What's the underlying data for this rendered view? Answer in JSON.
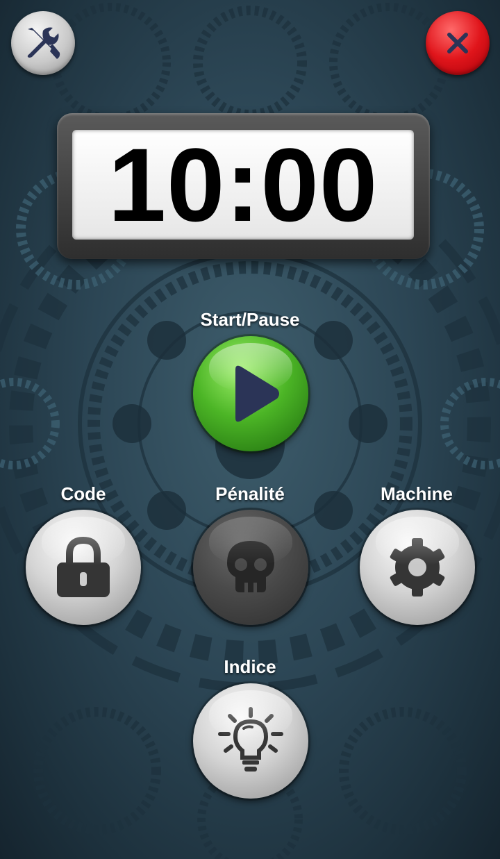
{
  "timer": {
    "display": "10:00"
  },
  "header": {
    "tools_icon": "tools-icon",
    "close_icon": "close-icon"
  },
  "controls": {
    "start_pause": {
      "label": "Start/Pause",
      "icon": "play-icon"
    },
    "code": {
      "label": "Code",
      "icon": "lock-icon"
    },
    "penalty": {
      "label": "Pénalité",
      "icon": "skull-icon"
    },
    "machine": {
      "label": "Machine",
      "icon": "gear-icon"
    },
    "hint": {
      "label": "Indice",
      "icon": "lightbulb-icon"
    }
  },
  "colors": {
    "play_green": "#4cb526",
    "close_red": "#e0151b",
    "icon_navy": "#2b3457",
    "icon_dark": "#353535"
  }
}
